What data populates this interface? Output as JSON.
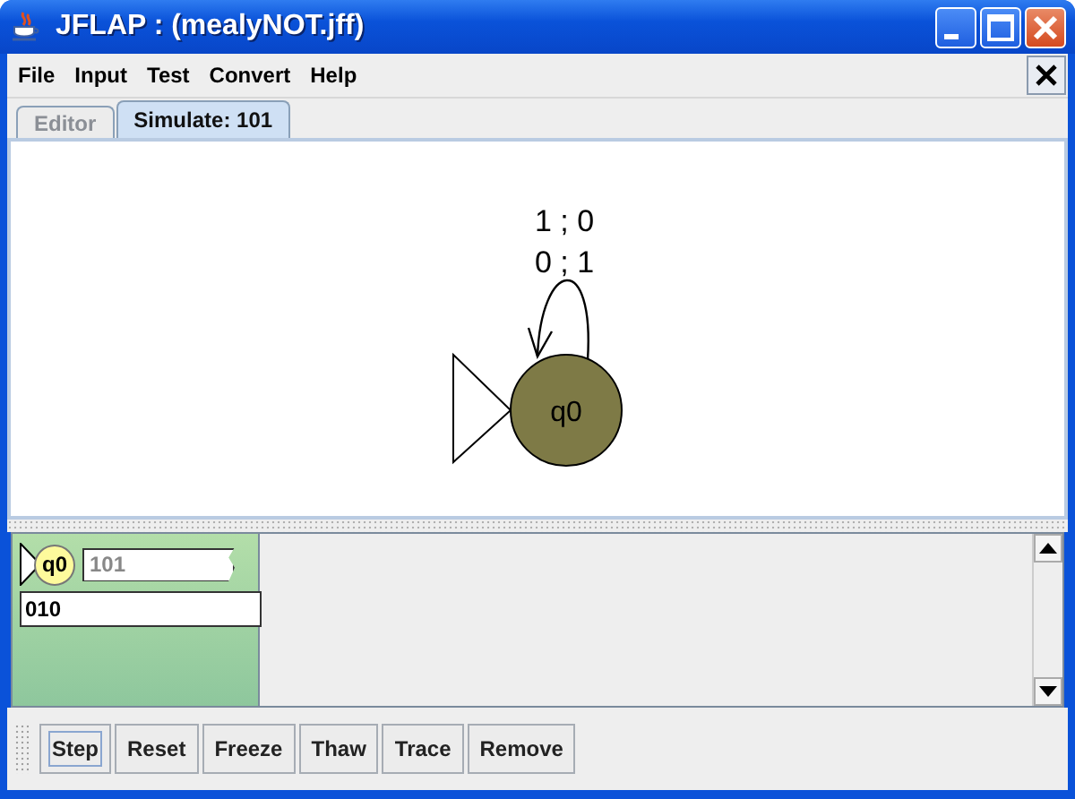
{
  "window": {
    "title": "JFLAP : (mealyNOT.jff)"
  },
  "menu": [
    "File",
    "Input",
    "Test",
    "Convert",
    "Help"
  ],
  "tabs": [
    {
      "label": "Editor",
      "selected": false
    },
    {
      "label": "Simulate: 101",
      "selected": true
    }
  ],
  "automaton": {
    "states": [
      {
        "name": "q0",
        "initial": true
      }
    ],
    "loop_labels": [
      "1 ; 0",
      "0 ; 1"
    ]
  },
  "configurations": [
    {
      "state": "q0",
      "initial": true,
      "input": "101",
      "output": "010"
    }
  ],
  "buttons": [
    {
      "label": "Step",
      "focused": true
    },
    {
      "label": "Reset",
      "focused": false
    },
    {
      "label": "Freeze",
      "focused": false
    },
    {
      "label": "Thaw",
      "focused": false
    },
    {
      "label": "Trace",
      "focused": false
    },
    {
      "label": "Remove",
      "focused": false
    }
  ]
}
